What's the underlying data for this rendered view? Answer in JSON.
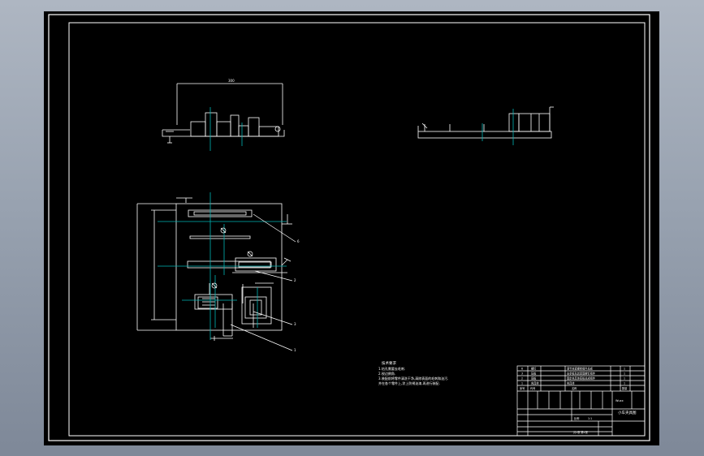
{
  "colors": {
    "background": "#000000",
    "frame": "#ffffff",
    "centerline": "#00b4b4",
    "leader": "#ffffff",
    "window_gradient_top": "#aeb6c2",
    "window_gradient_bottom": "#7e8898"
  },
  "drawing": {
    "balloons": [
      "6",
      "2",
      "3",
      "1"
    ],
    "notes": {
      "title": "技术要求",
      "line1": "1.钻孔需要去毛刺.",
      "line2": "2.锐边倒角.",
      "line3": "3.装配前将零件清洗干净,清除表面的毛刺和油污.",
      "line4": "  并在各个零件上,涂上防锈油漆,再进行装配."
    },
    "title_block": {
      "title": "小车夹具图",
      "company": "Wuxx",
      "scale_label": "比例",
      "scale_value": "1:1",
      "sheet": "共1张 第1张",
      "rows": [
        {
          "no": "6",
          "name": "螺钉",
          "desc": "调节夹紧螺栓组件总成",
          "qty": "1"
        },
        {
          "no": "3",
          "name": "压板",
          "desc": "支承板及其紧固螺钉组件",
          "qty": "1"
        },
        {
          "no": "2",
          "name": "底板",
          "desc": "固定夹具体底板总成组件",
          "qty": "1"
        },
        {
          "no": "1",
          "name": "夹具体",
          "desc": "夹具体",
          "qty": "1"
        }
      ],
      "header": {
        "no": "序号",
        "name": "代号",
        "desc": "名称",
        "qty": "数量"
      }
    }
  }
}
